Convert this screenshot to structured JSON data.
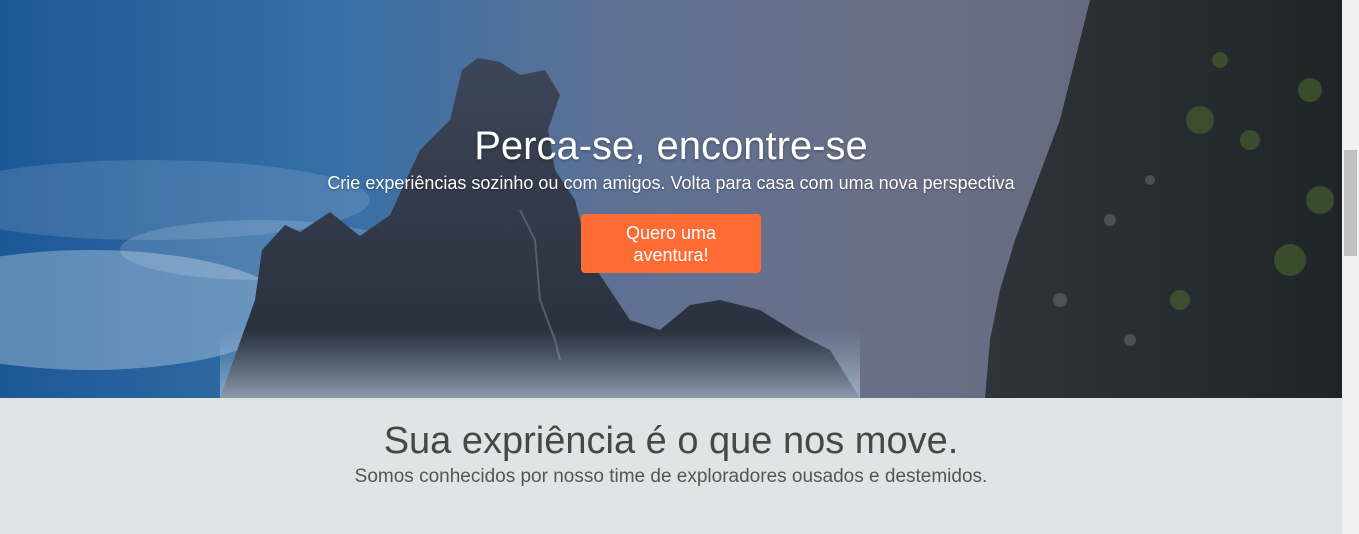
{
  "hero": {
    "title": "Perca-se, encontre-se",
    "subtitle": "Crie experiências sozinho ou com amigos. Volta para casa com uma nova perspectiva",
    "cta_label": "Quero uma aventura!",
    "cta_color": "#ff6b35",
    "background": "mountain-landscape-image"
  },
  "about": {
    "title": "Sua expriência é o que nos move.",
    "subtitle": "Somos conhecidos por nosso time de exploradores ousados e destemidos.",
    "background_color": "#e0e4e4"
  },
  "scrollbar": {
    "present": true
  }
}
